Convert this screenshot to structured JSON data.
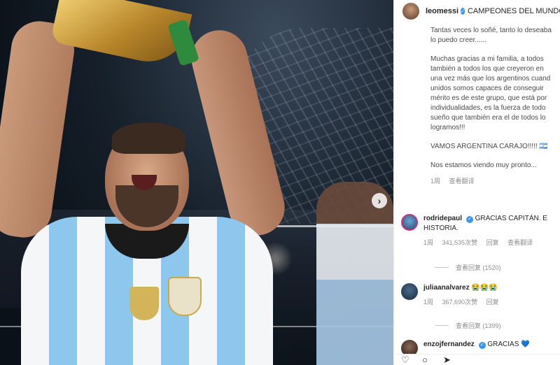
{
  "post": {
    "username": "leomessi",
    "caption_title": "CAMPEONES DEL MUNDO!!!!!!!",
    "caption_lines": [
      "Tantas veces lo soñé, tanto lo deseaba",
      "lo puedo creer......",
      "Muchas gracias a mi familia, a todos",
      "también a todos los que creyeron en",
      "una vez más que los argentinos cuand",
      "unidos somos capaces de conseguir",
      "mérito es de este grupo, que está por",
      "individualidades, es la fuerza de todo",
      "sueño que también era el de todos lo",
      "logramos!!!",
      "VAMOS ARGENTINA CARAJO!!!!! 🇦🇷",
      "Nos estamos viendo muy pronto..."
    ],
    "time": "1周",
    "see_translation": "查看翻译"
  },
  "comments": [
    {
      "username": "rodridepaul",
      "text_line1": "GRACIAS CAPITÁN. E",
      "text_line2": "HISTORIA.",
      "time": "1周",
      "likes": "341,535次赞",
      "reply": "回复",
      "see_translation": "查看翻译",
      "view_replies": "查看回复 (1520)"
    },
    {
      "username": "juliaanalvarez",
      "text_line1": "😭😭😭",
      "time": "1周",
      "likes": "367,690次赞",
      "reply": "回复",
      "view_replies": "查看回复 (1399)"
    },
    {
      "username": "enzojfernandez",
      "text_line1": "GRACIAS 💙"
    }
  ],
  "icons": [
    "heart-icon",
    "comment-icon",
    "share-icon",
    "next-arrow-icon",
    "verified-icon"
  ],
  "colors": {
    "accent": "#3897f0",
    "text": "#262626",
    "muted": "#8e8e8e"
  }
}
